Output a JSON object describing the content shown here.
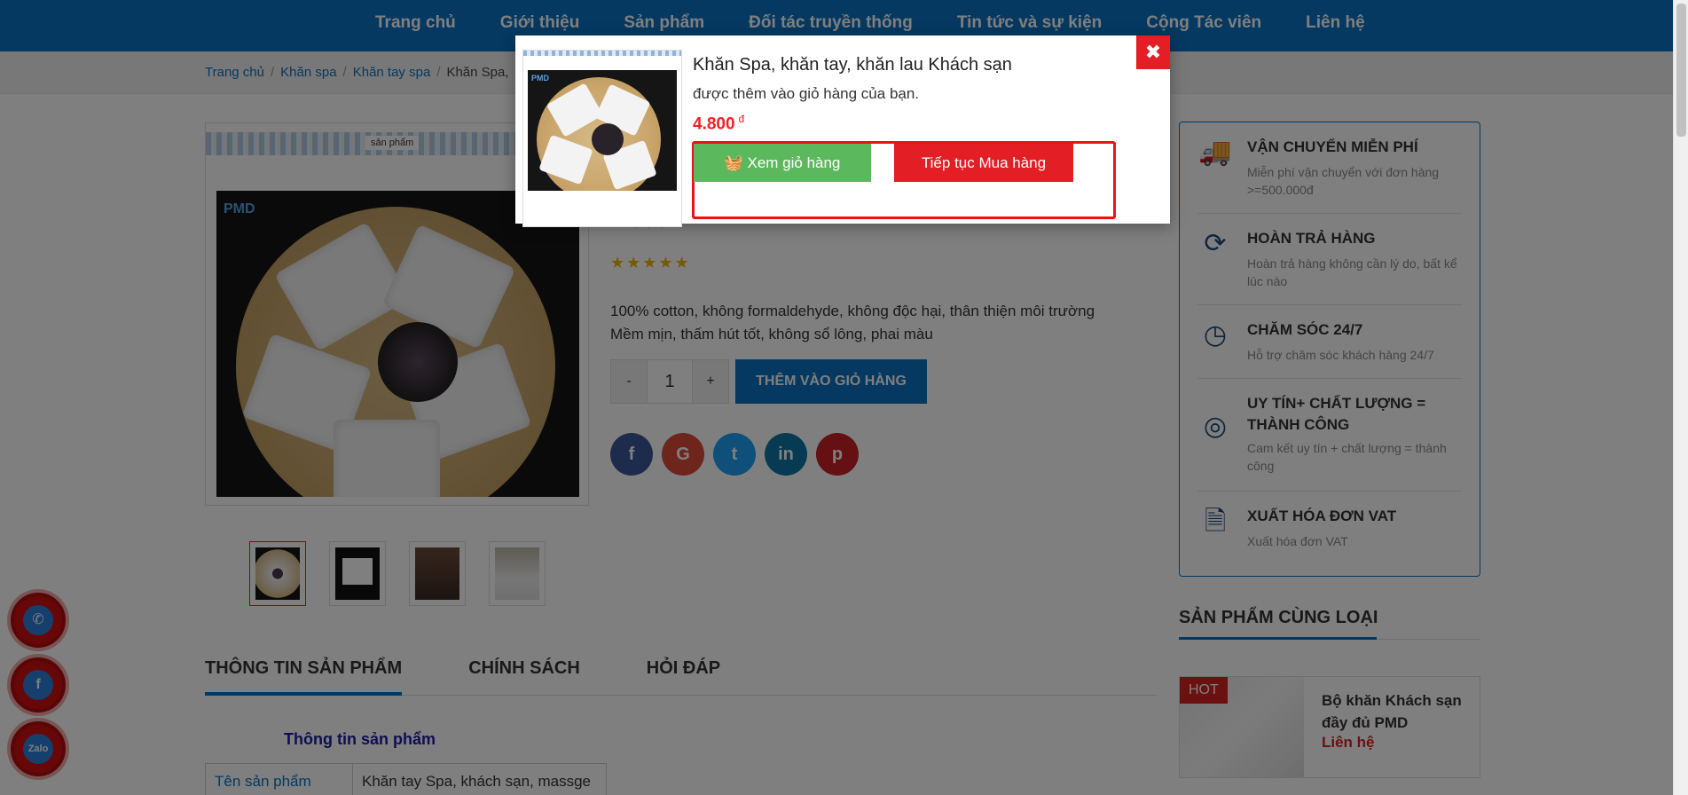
{
  "nav": {
    "items": [
      "Trang chủ",
      "Giới thiệu",
      "Sản phẩm",
      "Đối tác truyền thống",
      "Tin tức và sự kiện",
      "Cộng Tác viên",
      "Liên hệ"
    ]
  },
  "breadcrumb": {
    "home": "Trang chủ",
    "cat1": "Khăn spa",
    "cat2": "Khăn tay spa",
    "current": "Khăn Spa,"
  },
  "product": {
    "image_strip_label": "sản phẩm",
    "logo_text": "PMD",
    "price_partial": "4.800",
    "rating_stars": 5,
    "stars": "★★★★★",
    "desc_line1": "100% cotton, không formaldehyde, không độc hại, thân thiện môi trường",
    "desc_line2": "Mềm mịn, thấm hút tốt, không sổ lông, phai màu",
    "qty_minus": "-",
    "qty_value": "1",
    "qty_plus": "+",
    "add_to_cart": "THÊM VÀO GIỎ HÀNG",
    "social": {
      "facebook": "f",
      "google": "G",
      "twitter": "t",
      "linkedin": "in",
      "pinterest": "p"
    }
  },
  "tabs": [
    "THÔNG TIN SẢN PHẨM",
    "CHÍNH SÁCH",
    "HỎI ĐÁP"
  ],
  "info": {
    "heading": "Thông tin sản phẩm",
    "row_key": "Tên sản phẩm",
    "row_value": "Khăn tay Spa, khách sạn, massge"
  },
  "policies": [
    {
      "title": "VẬN CHUYỂN MIỄN PHÍ",
      "sub": "Miễn phí vận chuyển với đơn hàng >=500.000đ",
      "icon": "truck-icon",
      "glyph": "🚚"
    },
    {
      "title": "HOÀN TRẢ HÀNG",
      "sub": "Hoàn trả hàng không cần lý do, bất kể lúc nào",
      "icon": "refresh-icon",
      "glyph": "⟳"
    },
    {
      "title": "CHĂM SÓC 24/7",
      "sub": "Hỗ trợ chăm sóc khách hàng 24/7",
      "icon": "clock-icon",
      "glyph": "◷"
    },
    {
      "title": "UY TÍN+ CHẤT LƯỢNG = THÀNH CÔNG",
      "sub": "Cam kết uy tín + chất lượng = thành công",
      "icon": "compass-icon",
      "glyph": "◎"
    },
    {
      "title": "XUẤT HÓA ĐƠN VAT",
      "sub": "Xuất hóa đơn VAT",
      "icon": "document-icon",
      "glyph": "🗎"
    }
  ],
  "related": {
    "title": "SẢN PHẨM CÙNG LOẠI",
    "badge": "HOT",
    "name": "Bộ khăn Khách sạn đầy đủ PMD",
    "price": "Liên hệ"
  },
  "floating": {
    "zalo": "Zalo",
    "facebook": "f",
    "phone": "✆"
  },
  "modal": {
    "logo_text": "PMD",
    "title": "Khăn Spa, khăn tay, khăn lau Khách sạn",
    "subtitle": "được thêm vào giỏ hàng của bạn.",
    "price": "4.800",
    "currency": "đ",
    "view_cart": "🧺 Xem giỏ hàng",
    "continue": "Tiếp tục Mua hàng",
    "close": "✖"
  },
  "colors": {
    "brand": "#0a72c2",
    "accent_red": "#e41e25",
    "green": "#5cb85c"
  }
}
